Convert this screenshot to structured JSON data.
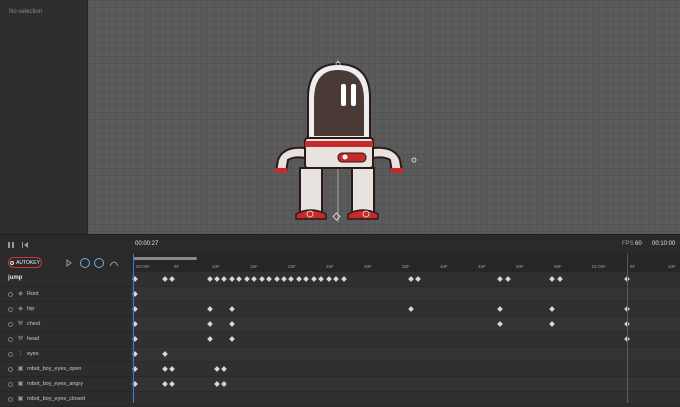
{
  "panel": {
    "no_selection": "No selection"
  },
  "transport": {
    "current_time": "00:00:27",
    "fps_label": "FPS",
    "fps_value": "60",
    "total_time": "00:10:00"
  },
  "toolbar": {
    "autokey_label": "AUTOKEY"
  },
  "timeline": {
    "animation_name": "jump",
    "ticks": [
      "00:00F",
      "5F",
      "10F",
      "15F",
      "20F",
      "25F",
      "30F",
      "35F",
      "40F",
      "45F",
      "50F",
      "55F",
      "01:00F",
      "5F",
      "10F"
    ],
    "layers": [
      {
        "label": "Root",
        "icon": "bone-icon"
      },
      {
        "label": "hip",
        "icon": "bone-icon"
      },
      {
        "label": "chest",
        "icon": "wrench-icon"
      },
      {
        "label": "head",
        "icon": "wrench-icon"
      },
      {
        "label": "eyes",
        "icon": "dots-icon"
      },
      {
        "label": "robot_boy_eyes_open",
        "icon": "image-icon"
      },
      {
        "label": "robot_boy_eyes_angry",
        "icon": "image-icon"
      },
      {
        "label": "robot_boy_eyes_closed",
        "icon": "image-icon"
      }
    ],
    "keyframes": [
      [
        0,
        4,
        5,
        10,
        11,
        12,
        13,
        14,
        15,
        16,
        17,
        18,
        19,
        20,
        21,
        22,
        23,
        24,
        25,
        26,
        27,
        28,
        37,
        38,
        49,
        50,
        56,
        57,
        66
      ],
      [
        0
      ],
      [
        0,
        10,
        13,
        37,
        49,
        56,
        66
      ],
      [
        0,
        10,
        13,
        49,
        56,
        66
      ],
      [
        0,
        10,
        13,
        66
      ],
      [
        0,
        4
      ],
      [
        0,
        4,
        5,
        11,
        12
      ],
      [
        0,
        4,
        5,
        11,
        12
      ]
    ]
  },
  "colors": {
    "accent": "#3b7dd8",
    "autokey_border": "#c23b3b",
    "viewport_bg": "#5b5b5b"
  }
}
